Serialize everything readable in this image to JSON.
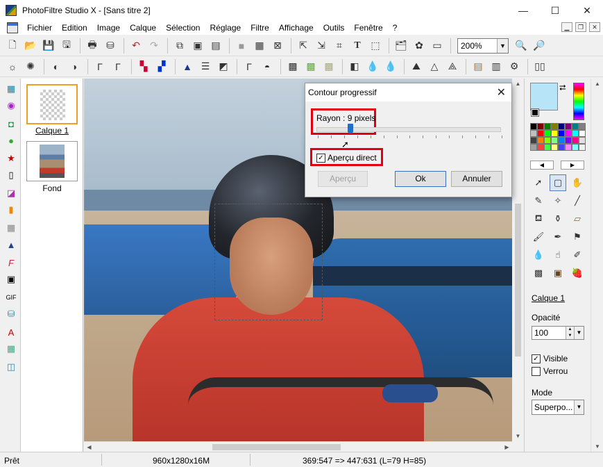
{
  "window": {
    "title": "PhotoFiltre Studio X - [Sans titre 2]"
  },
  "menu": [
    "Fichier",
    "Edition",
    "Image",
    "Calque",
    "Sélection",
    "Réglage",
    "Filtre",
    "Affichage",
    "Outils",
    "Fenêtre",
    "?"
  ],
  "toolbar": {
    "zoom": "200%"
  },
  "layers": [
    {
      "label": "Calque 1",
      "selected": true
    },
    {
      "label": "Fond",
      "selected": false
    }
  ],
  "dialog": {
    "title": "Contour progressif",
    "radius_label": "Rayon : 9 pixels",
    "radius_value": 9,
    "live_preview_label": "Aperçu direct",
    "live_preview_checked": true,
    "buttons": {
      "preview": "Aperçu",
      "ok": "Ok",
      "cancel": "Annuler"
    }
  },
  "panel": {
    "active_layer": "Calque 1",
    "opacity_label": "Opacité",
    "opacity_value": "100",
    "visible_label": "Visible",
    "visible_checked": true,
    "lock_label": "Verrou",
    "lock_checked": false,
    "mode_label": "Mode",
    "mode_value": "Superpo..."
  },
  "colors": {
    "foreground": "#b8e4f8",
    "background": "#000000",
    "highlight": "#e00010",
    "palette": [
      "#000000",
      "#800000",
      "#008000",
      "#808000",
      "#000080",
      "#800080",
      "#008080",
      "#808080",
      "#c0c0c0",
      "#ff0000",
      "#00ff00",
      "#ffff00",
      "#0000ff",
      "#ff00ff",
      "#00ffff",
      "#ffffff",
      "#404040",
      "#ff8000",
      "#80ff00",
      "#80ff80",
      "#0080ff",
      "#8000ff",
      "#ff0080",
      "#e0e0e0",
      "#a0a0a0",
      "#ff4040",
      "#40ff40",
      "#ffff80",
      "#4040ff",
      "#ff80ff",
      "#80ffff",
      "#f0f0f0"
    ]
  },
  "status": {
    "state": "Prêt",
    "image_info": "960x1280x16M",
    "coords": "369:547 => 447:631 (L=79  H=85)"
  }
}
